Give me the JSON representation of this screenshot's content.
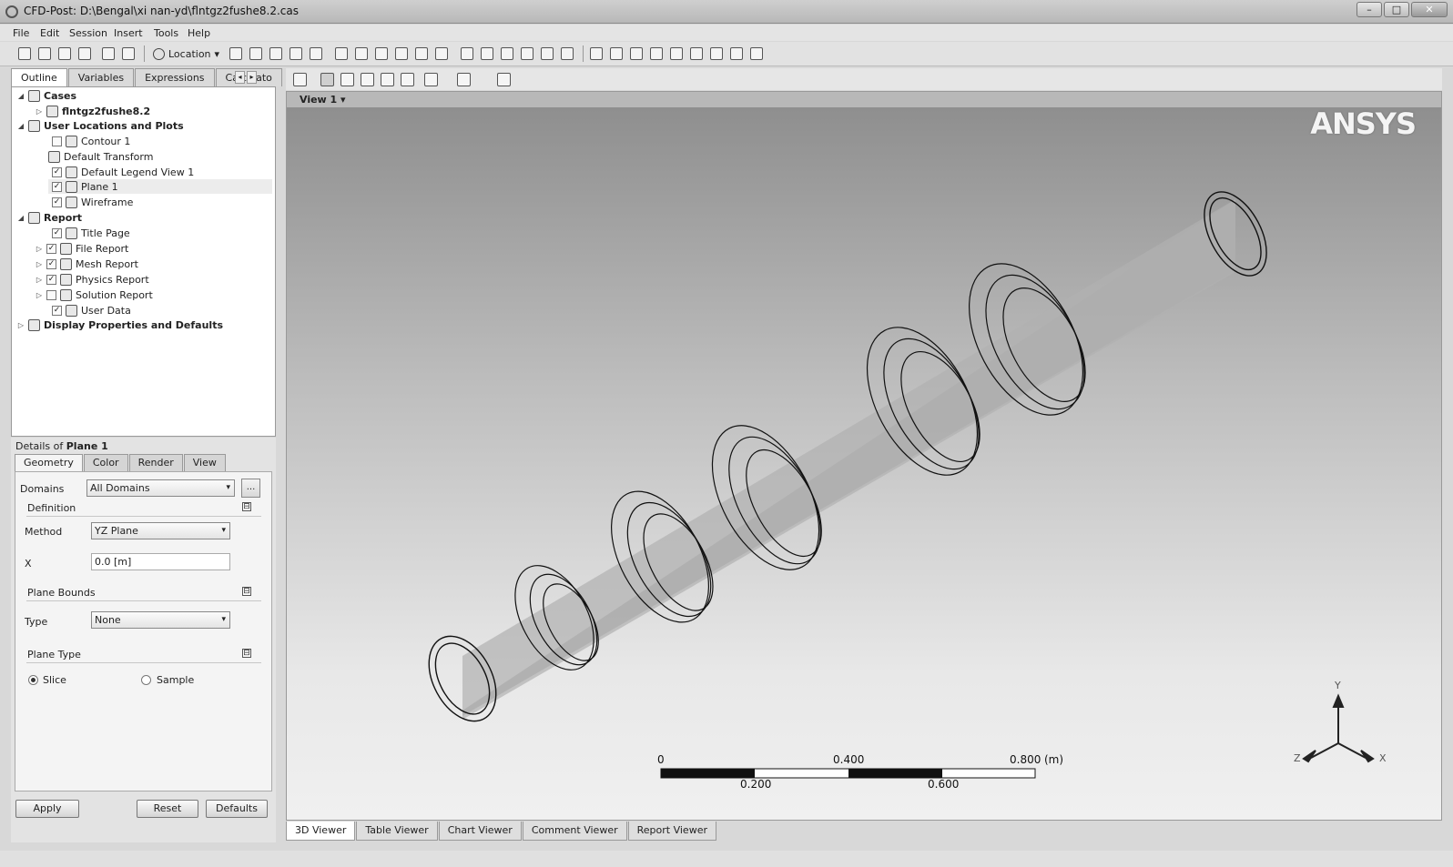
{
  "window": {
    "title": "CFD-Post: D:\\Bengal\\xi nan-yd\\flntgz2fushe8.2.cas",
    "controls": {
      "minimize": "–",
      "maximize": "□",
      "close": "✕"
    }
  },
  "menu": [
    "File",
    "Edit",
    "Session",
    "Insert",
    "Tools",
    "Help"
  ],
  "toolbar": {
    "location_label": "Location",
    "location_arrow": "▾"
  },
  "outline_tabs": [
    "Outline",
    "Variables",
    "Expressions",
    "Calculato"
  ],
  "tab_scroll": [
    "◂",
    "▸"
  ],
  "tree": {
    "cases": "Cases",
    "case_file": "flntgz2fushe8.2",
    "user_locations": "User Locations and Plots",
    "contour": "Contour 1",
    "default_transform": "Default Transform",
    "legend": "Default Legend View 1",
    "plane": "Plane 1",
    "wireframe": "Wireframe",
    "report": "Report",
    "title_page": "Title Page",
    "file_report": "File Report",
    "mesh_report": "Mesh Report",
    "physics_report": "Physics Report",
    "solution_report": "Solution Report",
    "user_data": "User Data",
    "display_props": "Display Properties and Defaults"
  },
  "details": {
    "title_prefix": "Details of",
    "title_object": "Plane 1",
    "tabs": [
      "Geometry",
      "Color",
      "Render",
      "View"
    ],
    "domains_label": "Domains",
    "domains_value": "All Domains",
    "dots": "...",
    "definition_header": "Definition",
    "method_label": "Method",
    "method_value": "YZ Plane",
    "x_label": "X",
    "x_value": "0.0 [m]",
    "plane_bounds_header": "Plane Bounds",
    "type_label": "Type",
    "type_value": "None",
    "plane_type_header": "Plane Type",
    "slice_label": "Slice",
    "sample_label": "Sample",
    "collapse_glyph": "⊟",
    "dropdown_arrow": "▾",
    "apply": "Apply",
    "reset": "Reset",
    "defaults": "Defaults"
  },
  "viewport": {
    "view_name": "View 1 ▾",
    "logo": "ANSYS",
    "scale": {
      "t0": "0",
      "t1": "0.200",
      "t2": "0.400",
      "t3": "0.600",
      "t4": "0.800",
      "unit": "(m)"
    },
    "axes": {
      "x": "X",
      "y": "Y",
      "z": "Z"
    }
  },
  "bottom_tabs": [
    "3D Viewer",
    "Table Viewer",
    "Chart Viewer",
    "Comment Viewer",
    "Report Viewer"
  ]
}
